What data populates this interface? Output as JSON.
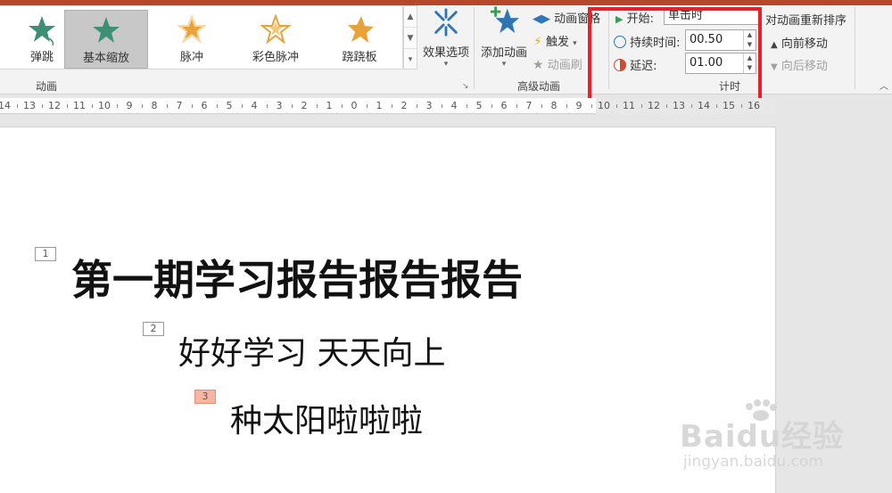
{
  "ribbon": {
    "gallery_items": [
      {
        "label": "弹跳",
        "icon": "bounce-star-icon",
        "color": "#3f8f76"
      },
      {
        "label": "基本缩放",
        "icon": "basic-zoom-star-icon",
        "color": "#3f8f76"
      },
      {
        "label": "脉冲",
        "icon": "pulse-star-icon",
        "color": "#e8a23a"
      },
      {
        "label": "彩色脉冲",
        "icon": "color-pulse-star-icon",
        "color": "#e8a23a"
      },
      {
        "label": "跷跷板",
        "icon": "teeter-star-icon",
        "color": "#e8a23a"
      }
    ],
    "effect_options": "效果选项",
    "animation_group": "动画",
    "add_animation": "添加动画",
    "animation_pane": "动画窗格",
    "trigger": "触发",
    "animation_painter": "动画刷",
    "advanced_group": "高级动画",
    "start_label": "开始:",
    "start_value": "单击时",
    "duration_label": "持续时间:",
    "duration_value": "00.50",
    "delay_label": "延迟:",
    "delay_value": "01.00",
    "timing_group": "计时",
    "reorder_title": "对动画重新排序",
    "move_earlier": "向前移动",
    "move_later": "向后移动"
  },
  "ruler": {
    "labels": [
      "14",
      "13",
      "12",
      "11",
      "10",
      "9",
      "8",
      "7",
      "6",
      "5",
      "4",
      "3",
      "2",
      "1",
      "0",
      "1",
      "2",
      "3",
      "4",
      "5",
      "6",
      "7",
      "8",
      "9",
      "10",
      "11",
      "12",
      "13",
      "14",
      "15",
      "16"
    ]
  },
  "slide": {
    "tags": [
      "1",
      "2",
      "3"
    ],
    "title": "第一期学习报告报告报告",
    "line1": "好好学习 天天向上",
    "line2": "种太阳啦啦啦"
  },
  "watermark": {
    "main": "Baidu经验",
    "sub": "jingyan.baidu.com"
  },
  "colors": {
    "accent": "#b7472a",
    "highlight": "#e8202a",
    "active_tag": "#f7b6a2"
  }
}
